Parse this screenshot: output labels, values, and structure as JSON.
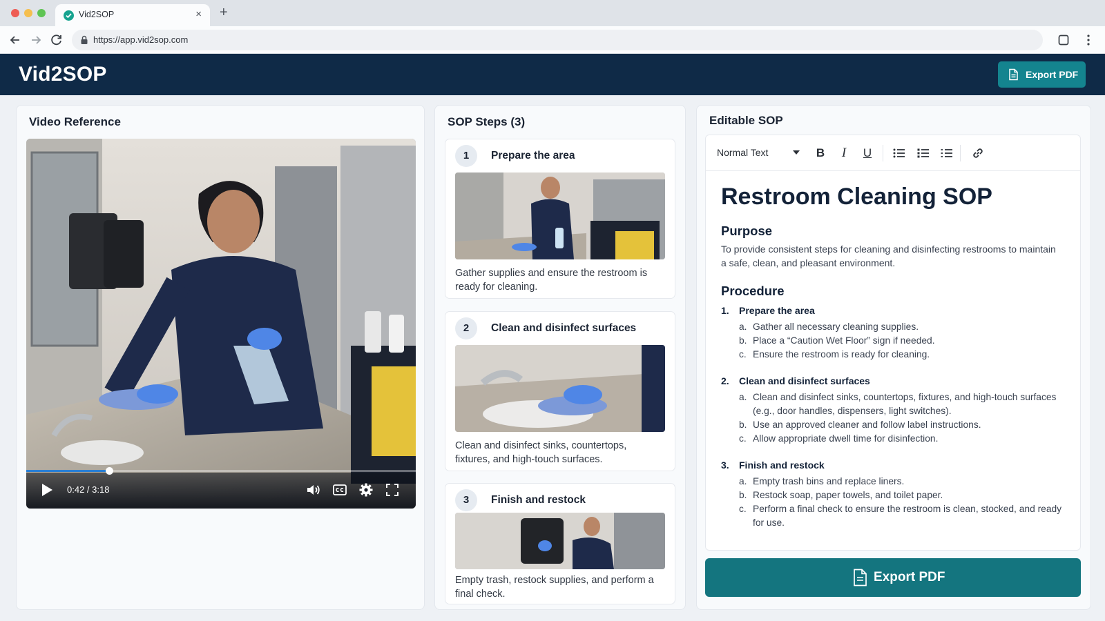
{
  "browser": {
    "tab_title": "Vid2SOP",
    "tab_close": "×",
    "new_tab": "+",
    "url": "https://app.vid2sop.com"
  },
  "app": {
    "brand": "Vid2SOP",
    "export_label": "Export PDF"
  },
  "video_panel": {
    "title": "Video Reference",
    "time": "0:42 / 3:18",
    "progress": 0.212
  },
  "steps_panel": {
    "title": "SOP Steps (3)",
    "steps": [
      {
        "num": "1",
        "title": "Prepare the area",
        "desc": "Gather supplies and ensure the restroom is ready for cleaning."
      },
      {
        "num": "2",
        "title": "Clean and disinfect surfaces",
        "desc": "Clean and disinfect sinks, countertops, fixtures, and high-touch surfaces."
      },
      {
        "num": "3",
        "title": "Finish and restock",
        "desc": "Empty trash, restock supplies, and perform a final check."
      }
    ]
  },
  "sop_panel": {
    "title": "Editable SOP",
    "toolbar": {
      "style": "Normal Text",
      "bold": "B",
      "italic": "I",
      "underline": "U"
    },
    "doc": {
      "title": "Restroom Cleaning SOP",
      "purpose_heading": "Purpose",
      "purpose_text": "To provide consistent steps for cleaning and disinfecting restrooms to maintain a safe, clean, and pleasant environment.",
      "procedure_heading": "Procedure",
      "procedure": [
        {
          "num": "1.",
          "title": "Prepare the area",
          "items": [
            {
              "l": "a.",
              "t": "Gather all necessary cleaning supplies."
            },
            {
              "l": "b.",
              "t": "Place a “Caution Wet Floor” sign if needed."
            },
            {
              "l": "c.",
              "t": "Ensure the restroom is ready for cleaning."
            }
          ]
        },
        {
          "num": "2.",
          "title": "Clean and disinfect surfaces",
          "items": [
            {
              "l": "a.",
              "t": "Clean and disinfect sinks, countertops, fixtures, and high-touch surfaces (e.g., door handles, dispensers, light switches)."
            },
            {
              "l": "b.",
              "t": "Use an approved cleaner and follow label instructions."
            },
            {
              "l": "c.",
              "t": "Allow appropriate dwell time for disinfection."
            }
          ]
        },
        {
          "num": "3.",
          "title": "Finish and restock",
          "items": [
            {
              "l": "a.",
              "t": "Empty trash bins and replace liners."
            },
            {
              "l": "b.",
              "t": "Restock soap, paper towels, and toilet paper."
            },
            {
              "l": "c.",
              "t": "Perform a final check to ensure the restroom is clean, stocked, and ready for use."
            }
          ]
        }
      ]
    },
    "export_label": "Export PDF"
  },
  "colors": {
    "header_bg": "#0f2a47",
    "accent": "#14848f",
    "export_big": "#14757f",
    "progress": "#2a7fd4"
  },
  "icons": [
    "favicon-icon",
    "back-icon",
    "forward-icon",
    "reload-icon",
    "lock-icon",
    "window-icon",
    "more-icon",
    "document-icon",
    "play-icon",
    "volume-icon",
    "captions-icon",
    "settings-icon",
    "fullscreen-icon",
    "chevron-down-icon",
    "bulleted-list-icon",
    "numbered-list-icon",
    "checklist-icon",
    "link-icon"
  ]
}
